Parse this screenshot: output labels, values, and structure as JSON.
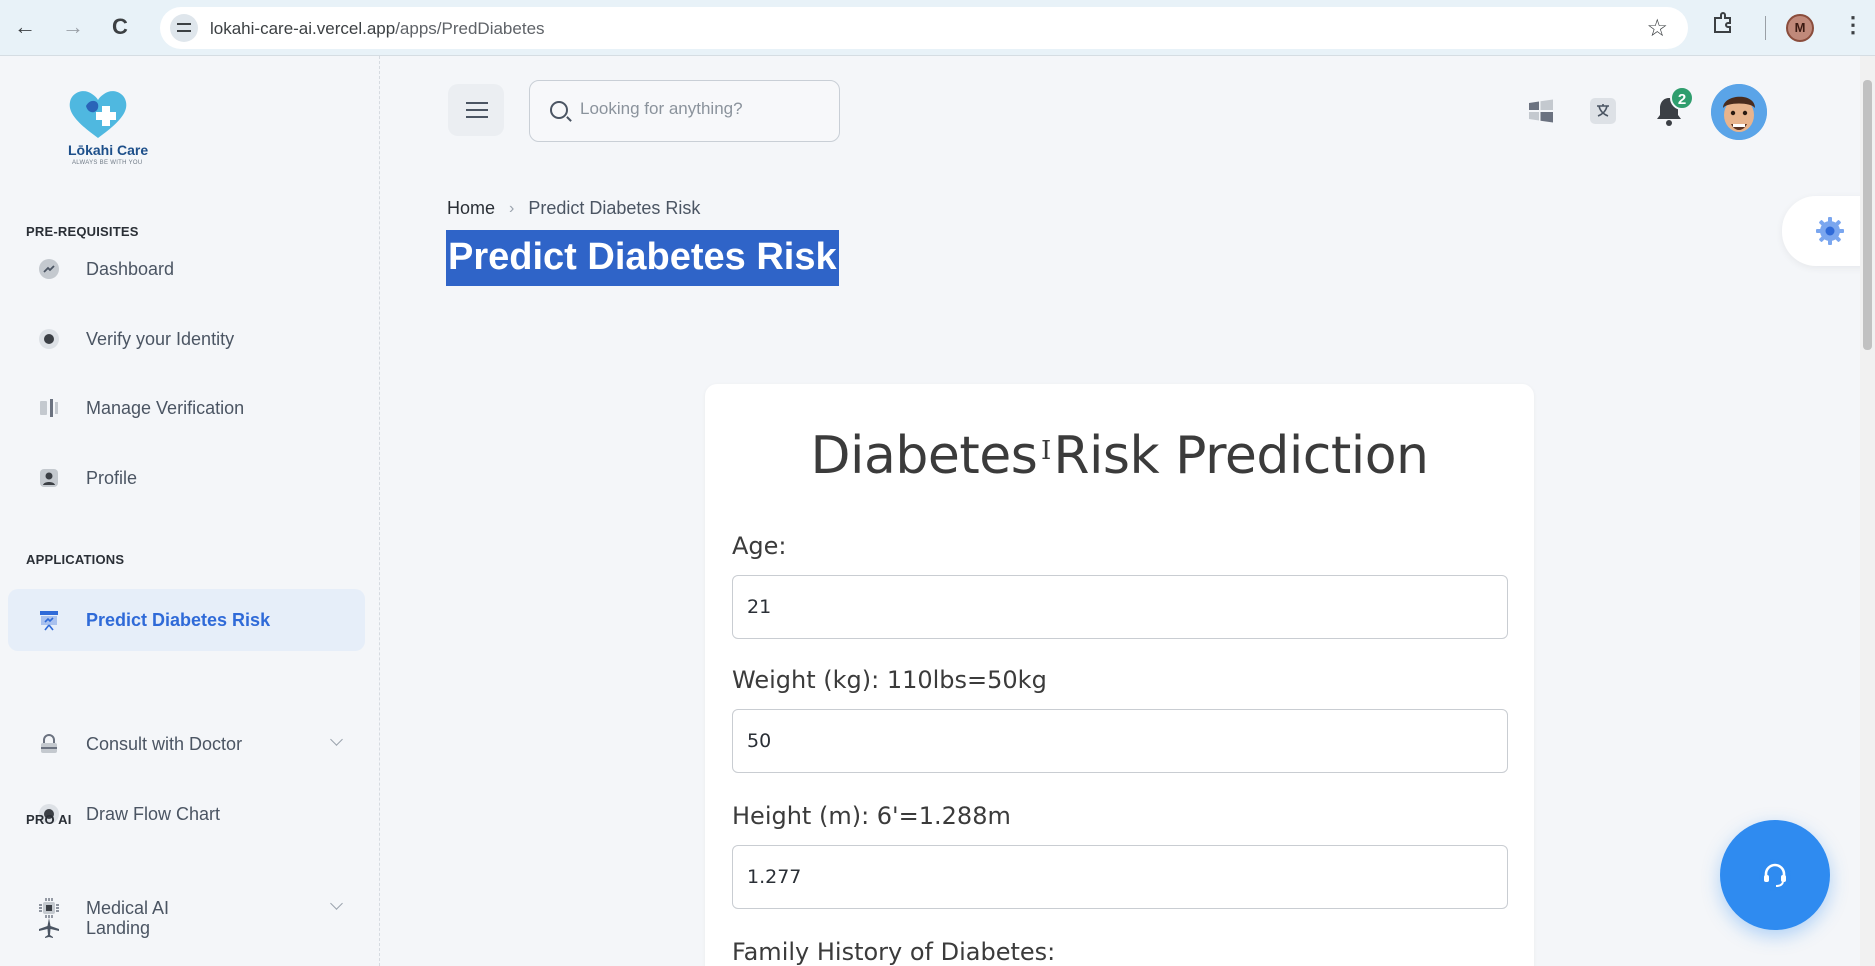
{
  "browser": {
    "url_host": "lokahi-care-ai.vercel.app",
    "url_path": "/apps/PredDiabetes",
    "account_initial": "M"
  },
  "brand": {
    "name": "Lōkahi Care",
    "tagline": "ALWAYS BE WITH YOU"
  },
  "sidebar": {
    "sections": [
      {
        "title": "PRE-REQUISITES"
      },
      {
        "title": "APPLICATIONS"
      },
      {
        "title": "PRO AI"
      }
    ],
    "items": [
      {
        "label": "Dashboard",
        "icon": "chart-icon"
      },
      {
        "label": "Verify your Identity",
        "icon": "radio-icon"
      },
      {
        "label": "Manage Verification",
        "icon": "panel-icon"
      },
      {
        "label": "Profile",
        "icon": "user-icon"
      },
      {
        "label": "Predict Diabetes Risk",
        "icon": "presentation-icon",
        "active": true
      },
      {
        "label": "Consult with Doctor",
        "icon": "lock-icon",
        "expandable": true
      },
      {
        "label": "Draw Flow Chart",
        "icon": "radio-icon"
      },
      {
        "label": "Medical AI",
        "icon": "chip-icon",
        "expandable": true
      },
      {
        "label": "Landing",
        "icon": "plane-icon"
      }
    ]
  },
  "topbar": {
    "search_placeholder": "Looking for anything?",
    "notification_count": "2"
  },
  "breadcrumb": {
    "home": "Home",
    "current": "Predict Diabetes Risk"
  },
  "page": {
    "title": "Predict Diabetes Risk"
  },
  "form": {
    "title": "Diabetes Risk Prediction",
    "fields": [
      {
        "label": "Age:",
        "value": "21"
      },
      {
        "label": "Weight (kg): 110lbs=50kg",
        "value": "50"
      },
      {
        "label": "Height (m): 6'=1.288m",
        "value": "1.277"
      },
      {
        "label": "Family History of Diabetes:"
      }
    ]
  },
  "colors": {
    "primary": "#2f6ad8",
    "title_highlight": "#2f64c8",
    "badge": "#2f9e6e",
    "fab": "#2f8bf0"
  }
}
